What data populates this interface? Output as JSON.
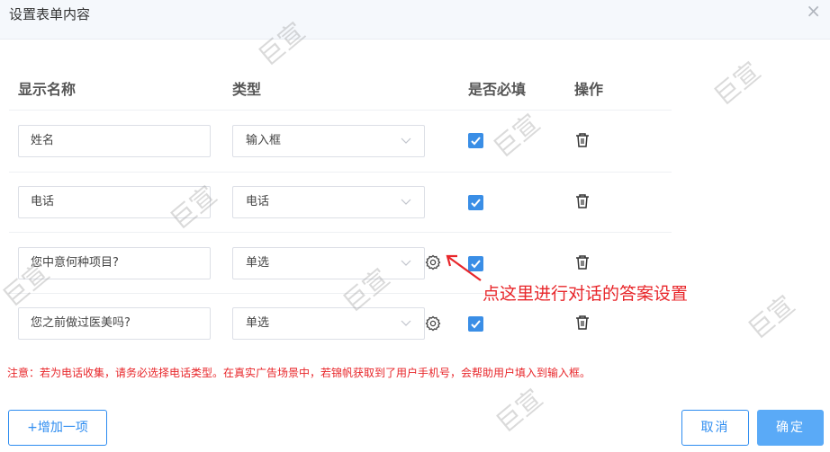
{
  "dialog": {
    "title": "设置表单内容",
    "close_label": "×"
  },
  "table": {
    "headers": [
      "显示名称",
      "类型",
      "是否必填",
      "操作"
    ],
    "rows": [
      {
        "name": "姓名",
        "type": "输入框",
        "required": true,
        "has_gear": false
      },
      {
        "name": "电话",
        "type": "电话",
        "required": true,
        "has_gear": false
      },
      {
        "name": "您中意何种项目?",
        "type": "单选",
        "required": true,
        "has_gear": true
      },
      {
        "name": "您之前做过医美吗?",
        "type": "单选",
        "required": true,
        "has_gear": true
      }
    ]
  },
  "annotation": {
    "text": "点这里进行对话的答案设置"
  },
  "notice": "注意：若为电话收集，请务必选择电话类型。在真实广告场景中，若锦帆获取到了用户手机号，会帮助用户填入到输入框。",
  "footer": {
    "add_label": "+增加一项",
    "cancel_label": "取消",
    "ok_label": "确定"
  },
  "watermark": "巨宣",
  "icons": {
    "close": "close-icon",
    "chevron": "chevron-down-icon",
    "gear": "gear-icon",
    "check": "check-icon",
    "trash": "trash-icon",
    "arrow": "arrow-icon"
  },
  "colors": {
    "primary": "#2d8cf0",
    "checkbox": "#3a8ee6",
    "ok_button": "#5aaaf7",
    "warning": "#e8262a"
  }
}
